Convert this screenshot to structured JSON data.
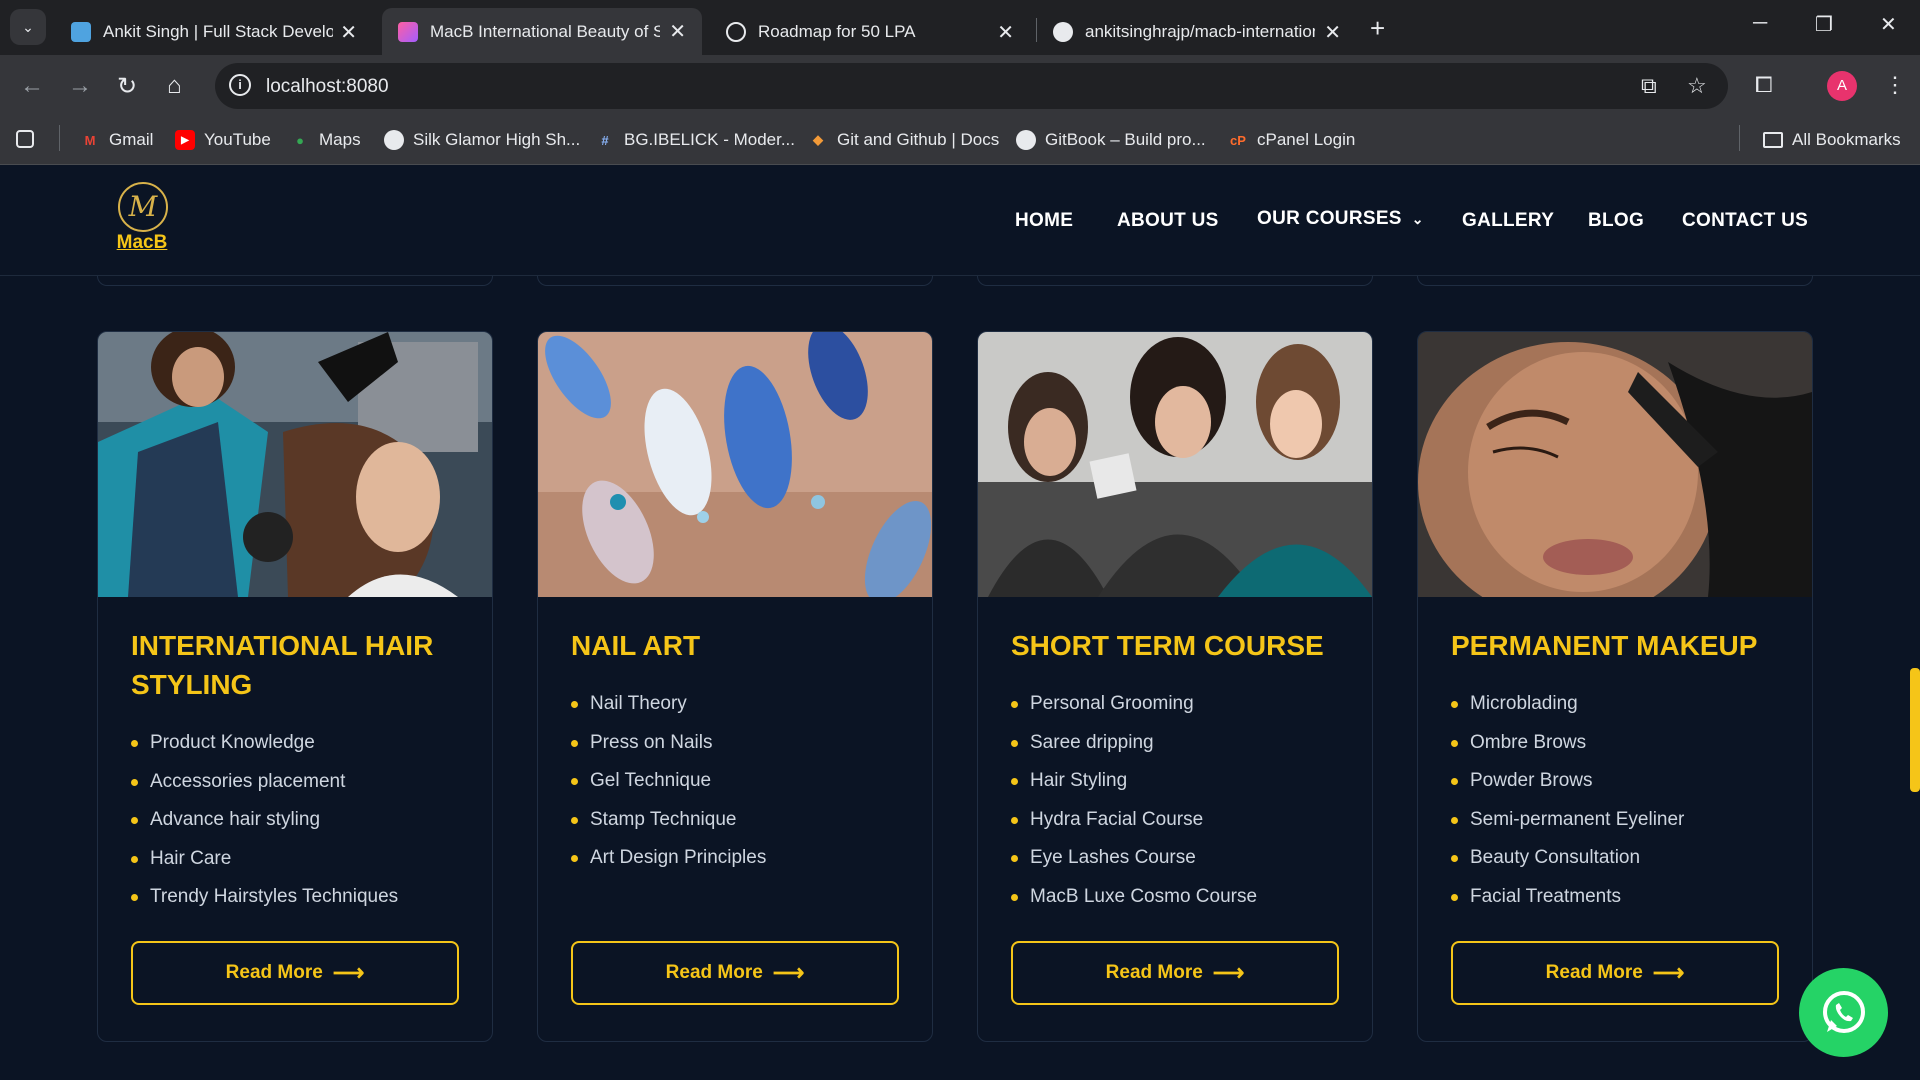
{
  "browser": {
    "tabs": [
      {
        "title": "Ankit Singh | Full Stack Develop"
      },
      {
        "title": "MacB International Beauty of Sc"
      },
      {
        "title": "Roadmap for 50 LPA"
      },
      {
        "title": "ankitsinghrajp/macb-internation"
      }
    ],
    "url": "localhost:8080",
    "profile_initial": "A",
    "bookmarks": [
      {
        "label": "Gmail"
      },
      {
        "label": "YouTube"
      },
      {
        "label": "Maps"
      },
      {
        "label": "Silk Glamor High Sh..."
      },
      {
        "label": "BG.IBELICK - Moder..."
      },
      {
        "label": "Git and Github | Docs"
      },
      {
        "label": "GitBook – Build pro..."
      },
      {
        "label": "cPanel Login"
      }
    ],
    "all_bookmarks": "All Bookmarks"
  },
  "site": {
    "logo_text": "MacB",
    "logo_mark": "M",
    "nav": {
      "home": "HOME",
      "about": "ABOUT US",
      "courses": "OUR COURSES",
      "gallery": "GALLERY",
      "blog": "BLOG",
      "contact": "CONTACT US"
    },
    "read_more": "Read More",
    "cards": [
      {
        "title": "INTERNATIONAL HAIR STYLING",
        "items": [
          "Product Knowledge",
          "Accessories placement",
          "Advance hair styling",
          "Hair Care",
          "Trendy Hairstyles Techniques"
        ]
      },
      {
        "title": "NAIL ART",
        "items": [
          "Nail Theory",
          "Press on Nails",
          "Gel Technique",
          "Stamp Technique",
          "Art Design Principles"
        ]
      },
      {
        "title": "SHORT TERM COURSE",
        "items": [
          "Personal Grooming",
          "Saree dripping",
          "Hair Styling",
          "Hydra Facial Course",
          "Eye Lashes Course",
          "MacB Luxe Cosmo Course"
        ]
      },
      {
        "title": "PERMANENT MAKEUP",
        "items": [
          "Microblading",
          "Ombre Brows",
          "Powder Brows",
          "Semi-permanent Eyeliner",
          "Beauty Consultation",
          "Facial Treatments"
        ]
      }
    ]
  },
  "colors": {
    "page_bg": "#0b1424",
    "accent": "#f5c518",
    "whatsapp": "#25d366"
  }
}
